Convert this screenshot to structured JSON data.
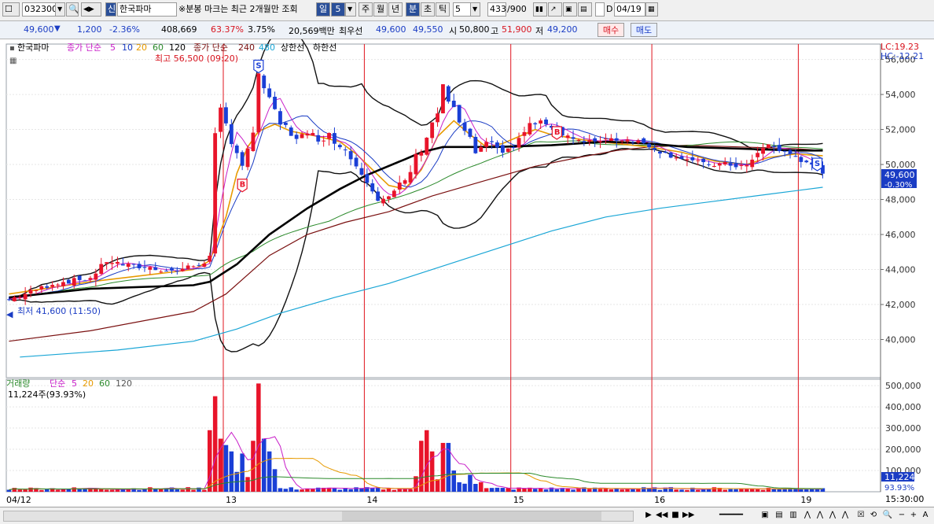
{
  "toolbar": {
    "stock_code": "032300",
    "stock_name_icon_label": "신",
    "stock_name": "한국파마",
    "notice": "※분봉 마크는 최근 2개월만 조회",
    "period_day": "일",
    "period_num": "5",
    "period_week": "주",
    "period_month": "월",
    "period_year": "년",
    "period_minute": "분",
    "period_second": "초",
    "period_tick": "틱",
    "interval_value": "5",
    "count_value": "433",
    "count_total": "/900",
    "check_d": "D",
    "date_value": "04/19"
  },
  "quote": {
    "price": "49,600",
    "change": "1,200",
    "change_pct": "-2.36%",
    "volume": "408,669",
    "ratio": "63.37%",
    "turnover": "3.75%",
    "amount": "20,569백만",
    "best_label": "최우선",
    "best_bid": "49,600",
    "best_ask": "49,550",
    "open_label": "시",
    "open": "50,800",
    "high_label": "고",
    "high": "51,900",
    "low_label": "저",
    "low": "49,200",
    "buy_button": "매수",
    "sell_button": "매도"
  },
  "colors": {
    "up": "#e8142a",
    "down": "#1a3fd6",
    "ma5": "#c81ec8",
    "ma10": "#1a3cc4",
    "ma20": "#e79a00",
    "ma60": "#2b8a2b",
    "ma120": "#000000",
    "ma240": "#7a1010",
    "ma480": "#1aa6d6",
    "session": "#e0141e",
    "price_tag_bg": "#1a3cc4"
  },
  "chart_data": {
    "type": "candlestick",
    "interval": "5분",
    "price_legend": {
      "name": "한국파마",
      "ma_label": "종가 단순",
      "periods": [
        "5",
        "10",
        "20",
        "60",
        "120",
        "240",
        "480"
      ],
      "bands": [
        "상한선",
        "하한선"
      ]
    },
    "volume_legend": {
      "name": "거래량",
      "ma_label": "단순",
      "periods": [
        "5",
        "20",
        "60",
        "120"
      ]
    },
    "max_label": "최고 56,500 (09:20)",
    "min_label": "최저 41,600 (11:50)",
    "lc_label": "LC:19.23",
    "hc_label": "HC:-12.21",
    "last_price_label": "49,600",
    "last_change_label": "-0.30%",
    "volume_info": "11,224주(93.93%)",
    "last_volume_label": "11,224",
    "last_volume_pct_label": "93.93%",
    "time_label": "15:30:00",
    "y_ticks": [
      40000,
      42000,
      44000,
      46000,
      48000,
      50000,
      52000,
      54000,
      56000
    ],
    "y_tick_labels": [
      "40,000",
      "42,000",
      "44,000",
      "46,000",
      "48,000",
      "50,000",
      "52,000",
      "54,000",
      "56,000"
    ],
    "y_range": [
      38000,
      56700
    ],
    "vol_ticks": [
      100000,
      200000,
      300000,
      400000,
      500000
    ],
    "vol_tick_labels": [
      "100,000",
      "200,000",
      "300,000",
      "400,000",
      "500,000"
    ],
    "vol_range": [
      0,
      530000
    ],
    "x_labels": [
      "04/12",
      "13",
      "14",
      "15",
      "16",
      "19"
    ],
    "session_bars": [
      15,
      40,
      66,
      93,
      119,
      146
    ],
    "bar_count": 160,
    "price_key": [
      [
        0,
        42300
      ],
      [
        3,
        42600
      ],
      [
        8,
        43200
      ],
      [
        15,
        43500
      ],
      [
        18,
        44500
      ],
      [
        22,
        44200
      ],
      [
        26,
        44100
      ],
      [
        30,
        43900
      ],
      [
        34,
        44200
      ],
      [
        35,
        44300
      ],
      [
        37,
        44600
      ],
      [
        37.7,
        51000
      ],
      [
        39,
        53000
      ],
      [
        41,
        51500
      ],
      [
        43,
        50000
      ],
      [
        45,
        51500
      ],
      [
        46,
        55300
      ],
      [
        48,
        53500
      ],
      [
        50,
        52300
      ],
      [
        52,
        51800
      ],
      [
        55,
        51500
      ],
      [
        58,
        51700
      ],
      [
        61,
        51300
      ],
      [
        63,
        50400
      ],
      [
        66,
        49300
      ],
      [
        68,
        48200
      ],
      [
        70,
        48000
      ],
      [
        73,
        49000
      ],
      [
        76,
        51000
      ],
      [
        79,
        53000
      ],
      [
        80,
        54300
      ],
      [
        82,
        53000
      ],
      [
        84,
        51800
      ],
      [
        86,
        50700
      ],
      [
        88,
        51000
      ],
      [
        91,
        50800
      ],
      [
        93,
        51000
      ],
      [
        96,
        52300
      ],
      [
        99,
        52400
      ],
      [
        102,
        51800
      ],
      [
        106,
        51200
      ],
      [
        110,
        51500
      ],
      [
        115,
        51400
      ],
      [
        118,
        51100
      ],
      [
        121,
        50600
      ],
      [
        124,
        50400
      ],
      [
        128,
        50000
      ],
      [
        132,
        50000
      ],
      [
        136,
        49900
      ],
      [
        138,
        50600
      ],
      [
        140,
        51200
      ],
      [
        142,
        50800
      ],
      [
        145,
        50500
      ],
      [
        147,
        50000
      ],
      [
        150,
        49600
      ]
    ],
    "ma20_key": [
      [
        0,
        42600
      ],
      [
        15,
        43300
      ],
      [
        34,
        44000
      ],
      [
        37,
        44500
      ],
      [
        40,
        47000
      ],
      [
        42,
        49500
      ],
      [
        44,
        51000
      ],
      [
        46,
        51900
      ],
      [
        49,
        52300
      ],
      [
        52,
        51900
      ],
      [
        57,
        51600
      ],
      [
        61,
        51300
      ],
      [
        64,
        50600
      ],
      [
        67,
        49700
      ],
      [
        70,
        48800
      ],
      [
        73,
        48600
      ],
      [
        76,
        49700
      ],
      [
        79,
        51600
      ],
      [
        82,
        52500
      ],
      [
        85,
        51700
      ],
      [
        88,
        51000
      ],
      [
        91,
        51200
      ],
      [
        94,
        51600
      ],
      [
        97,
        52000
      ],
      [
        100,
        51700
      ],
      [
        106,
        51400
      ],
      [
        112,
        51200
      ],
      [
        118,
        51000
      ],
      [
        124,
        50700
      ],
      [
        130,
        50200
      ],
      [
        136,
        50000
      ],
      [
        140,
        50400
      ],
      [
        145,
        50600
      ],
      [
        150,
        50500
      ]
    ],
    "ma120_key": [
      [
        0,
        42400
      ],
      [
        15,
        42900
      ],
      [
        34,
        43100
      ],
      [
        37,
        43300
      ],
      [
        42,
        44300
      ],
      [
        48,
        46000
      ],
      [
        55,
        47500
      ],
      [
        61,
        48600
      ],
      [
        66,
        49400
      ],
      [
        73,
        50300
      ],
      [
        76,
        50700
      ],
      [
        80,
        51000
      ],
      [
        85,
        51000
      ],
      [
        90,
        51000
      ],
      [
        100,
        51100
      ],
      [
        110,
        51300
      ],
      [
        118,
        51200
      ],
      [
        125,
        51000
      ],
      [
        135,
        50900
      ],
      [
        145,
        50800
      ],
      [
        150,
        50800
      ]
    ],
    "ma240_key": [
      [
        0,
        39900
      ],
      [
        15,
        40500
      ],
      [
        34,
        41600
      ],
      [
        40,
        42600
      ],
      [
        48,
        44800
      ],
      [
        55,
        46000
      ],
      [
        62,
        46700
      ],
      [
        70,
        47300
      ],
      [
        78,
        48200
      ],
      [
        88,
        49100
      ],
      [
        97,
        49900
      ],
      [
        105,
        50400
      ],
      [
        112,
        50800
      ],
      [
        118,
        51000
      ],
      [
        125,
        51100
      ],
      [
        135,
        51000
      ],
      [
        145,
        50900
      ],
      [
        150,
        50800
      ]
    ],
    "ma480_key": [
      [
        2,
        39000
      ],
      [
        20,
        39400
      ],
      [
        34,
        39900
      ],
      [
        42,
        40600
      ],
      [
        50,
        41500
      ],
      [
        60,
        42400
      ],
      [
        70,
        43200
      ],
      [
        80,
        44200
      ],
      [
        90,
        45200
      ],
      [
        100,
        46200
      ],
      [
        110,
        47000
      ],
      [
        120,
        47500
      ],
      [
        130,
        47900
      ],
      [
        140,
        48300
      ],
      [
        150,
        48700
      ]
    ],
    "volume_spikes": [
      [
        37,
        290000
      ],
      [
        37.6,
        330000
      ],
      [
        38,
        450000
      ],
      [
        38.4,
        340000
      ],
      [
        39,
        250000
      ],
      [
        40,
        220000
      ],
      [
        41,
        190000
      ],
      [
        43,
        180000
      ],
      [
        45,
        240000
      ],
      [
        45.6,
        510000
      ],
      [
        46,
        350000
      ],
      [
        47,
        250000
      ],
      [
        48,
        190000
      ],
      [
        76,
        240000
      ],
      [
        77,
        290000
      ],
      [
        78,
        190000
      ],
      [
        80,
        200000
      ],
      [
        80.6,
        230000
      ],
      [
        81,
        180000
      ],
      [
        82,
        100000
      ],
      [
        85,
        80000
      ]
    ]
  }
}
